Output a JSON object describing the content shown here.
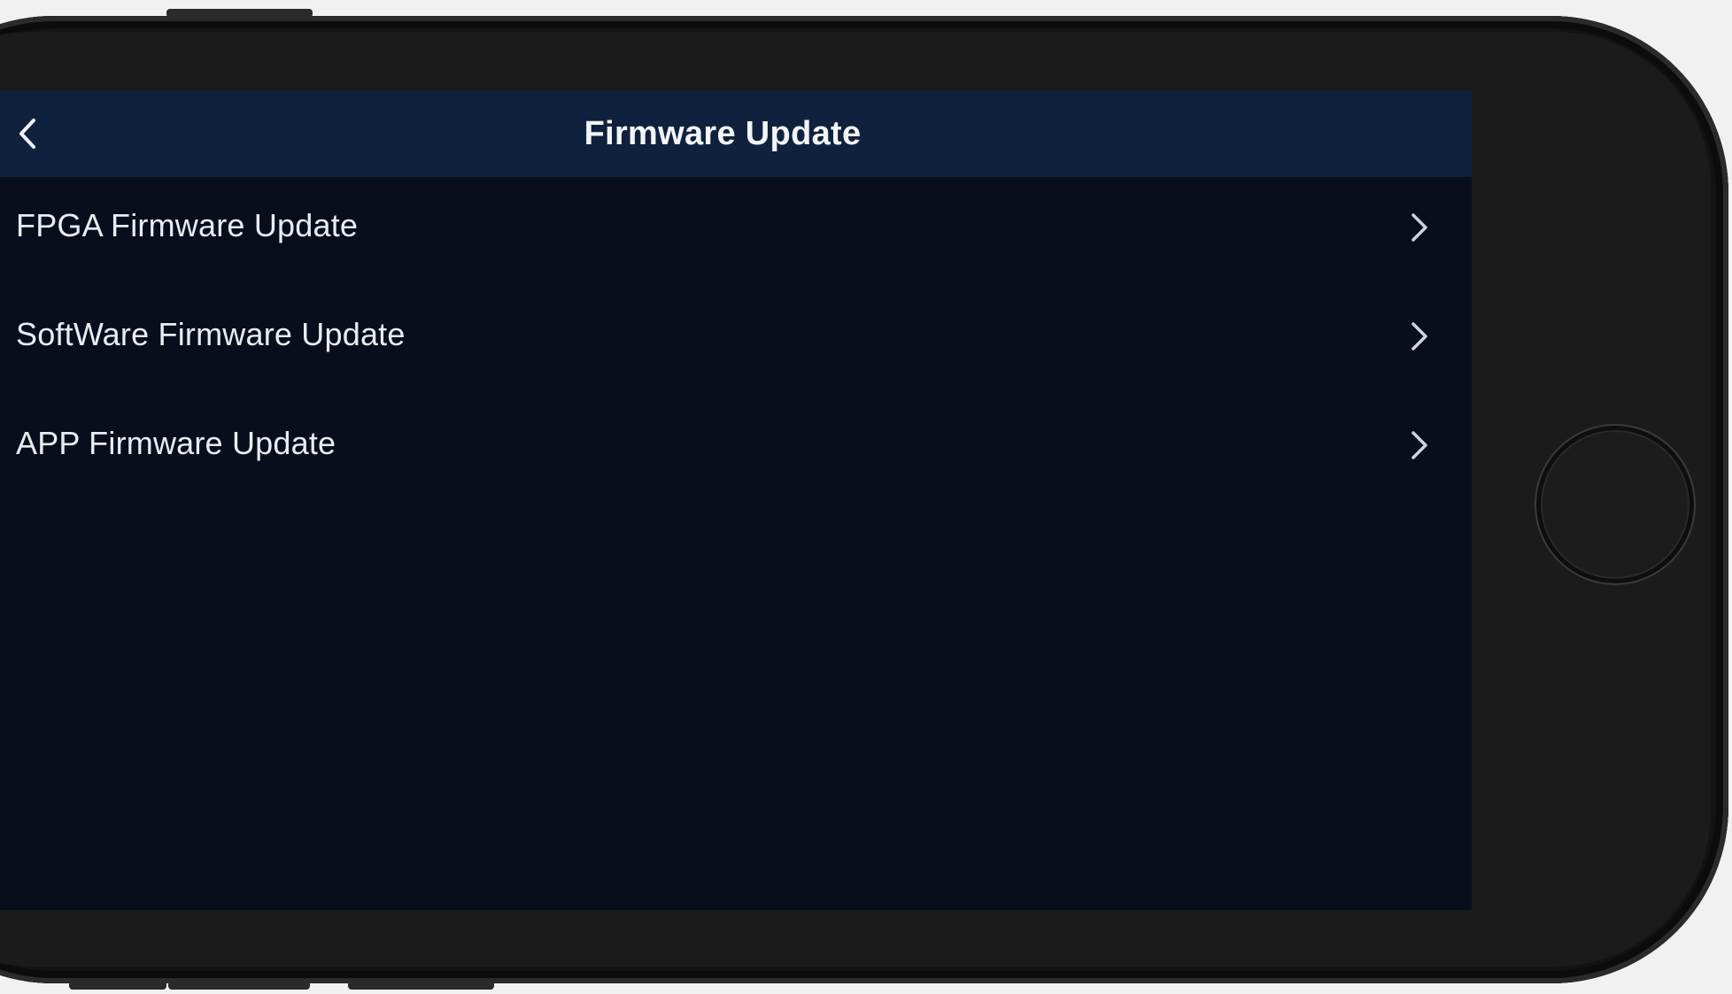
{
  "header": {
    "title": "Firmware Update",
    "back_icon": "chevron-left-icon"
  },
  "menu": {
    "items": [
      {
        "label": "FPGA Firmware Update",
        "icon": "chevron-right-icon"
      },
      {
        "label": "SoftWare Firmware Update",
        "icon": "chevron-right-icon"
      },
      {
        "label": "APP Firmware Update",
        "icon": "chevron-right-icon"
      }
    ]
  },
  "colors": {
    "navbar_background": "#10213d",
    "screen_background": "#0a0e1c",
    "text": "#e9ecf1",
    "device_frame": "#131313"
  }
}
